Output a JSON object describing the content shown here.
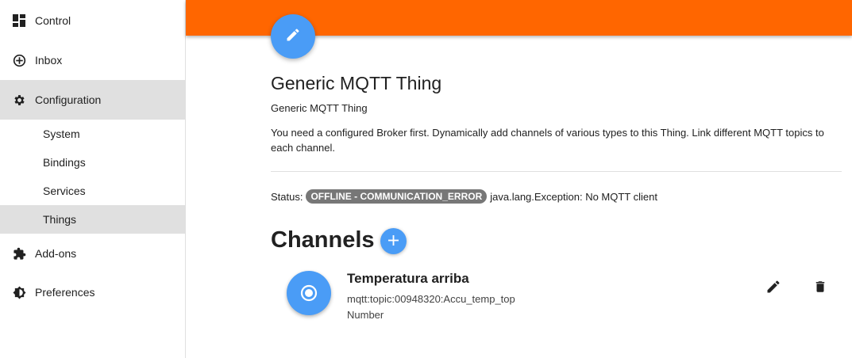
{
  "sidebar": {
    "items": [
      {
        "label": "Control",
        "icon": "dashboard-icon"
      },
      {
        "label": "Inbox",
        "icon": "add-circle-icon"
      },
      {
        "label": "Configuration",
        "icon": "gear-icon"
      },
      {
        "label": "System"
      },
      {
        "label": "Bindings"
      },
      {
        "label": "Services"
      },
      {
        "label": "Things"
      },
      {
        "label": "Add-ons",
        "icon": "puzzle-icon"
      },
      {
        "label": "Preferences",
        "icon": "brightness-icon"
      }
    ]
  },
  "header": {
    "color": "#ff6600"
  },
  "thing": {
    "title": "Generic MQTT Thing",
    "type": "Generic MQTT Thing",
    "description": "You need a configured Broker first. Dynamically add channels of various types to this Thing. Link different MQTT topics to each channel.",
    "status_label": "Status:",
    "status_badge": "OFFLINE - COMMUNICATION_ERROR",
    "status_detail": "java.lang.Exception: No MQTT client"
  },
  "channels": {
    "title": "Channels",
    "add_label": "+",
    "items": [
      {
        "name": "Temperatura arriba",
        "uid": "mqtt:topic:00948320:Accu_temp_top",
        "type": "Number"
      }
    ]
  },
  "colors": {
    "accent": "#4a9cf6",
    "topbar": "#ff6600",
    "active": "#e0e0e0",
    "badge": "#777777"
  }
}
